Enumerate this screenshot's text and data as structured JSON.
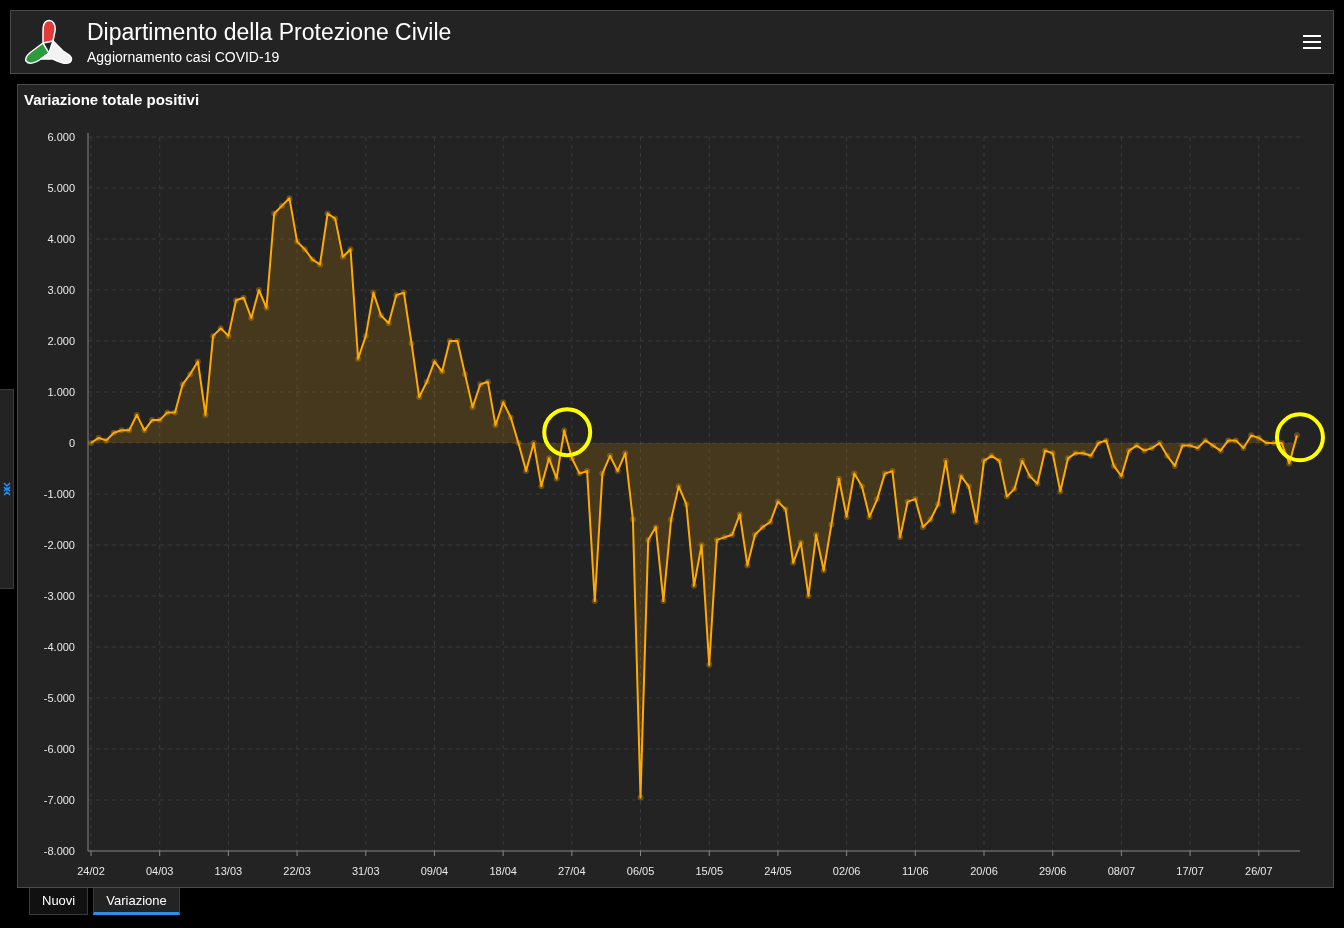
{
  "header": {
    "title": "Dipartimento della Protezione Civile",
    "subtitle": "Aggiornamento casi COVID-19"
  },
  "panel": {
    "title": "Variazione totale positivi",
    "chart_data": {
      "type": "area",
      "grid": true,
      "categories": [
        "24/02",
        null,
        null,
        null,
        null,
        null,
        null,
        null,
        null,
        "04/03",
        null,
        null,
        null,
        null,
        null,
        null,
        null,
        null,
        "13/03",
        null,
        null,
        null,
        null,
        null,
        null,
        null,
        null,
        "22/03",
        null,
        null,
        null,
        null,
        null,
        null,
        null,
        null,
        "31/03",
        null,
        null,
        null,
        null,
        null,
        null,
        null,
        null,
        "09/04",
        null,
        null,
        null,
        null,
        null,
        null,
        null,
        null,
        "18/04",
        null,
        null,
        null,
        null,
        null,
        null,
        null,
        null,
        "27/04",
        null,
        null,
        null,
        null,
        null,
        null,
        null,
        null,
        "06/05",
        null,
        null,
        null,
        null,
        null,
        null,
        null,
        null,
        "15/05",
        null,
        null,
        null,
        null,
        null,
        null,
        null,
        null,
        "24/05",
        null,
        null,
        null,
        null,
        null,
        null,
        null,
        null,
        "02/06",
        null,
        null,
        null,
        null,
        null,
        null,
        null,
        null,
        "11/06",
        null,
        null,
        null,
        null,
        null,
        null,
        null,
        null,
        "20/06",
        null,
        null,
        null,
        null,
        null,
        null,
        null,
        null,
        "29/06",
        null,
        null,
        null,
        null,
        null,
        null,
        null,
        null,
        "08/07",
        null,
        null,
        null,
        null,
        null,
        null,
        null,
        null,
        "17/07",
        null,
        null,
        null,
        null,
        null,
        null,
        null,
        null,
        "26/07",
        null,
        null,
        null,
        null,
        null
      ],
      "series": [
        {
          "color": "#ffaa00",
          "values": [
            0,
            100,
            50,
            200,
            250,
            250,
            550,
            250,
            450,
            450,
            600,
            600,
            1150,
            1350,
            1600,
            550,
            2100,
            2250,
            2100,
            2800,
            2850,
            2450,
            3000,
            2650,
            4500,
            4650,
            4800,
            3950,
            3800,
            3600,
            3500,
            4500,
            4400,
            3650,
            3800,
            1650,
            2100,
            2950,
            2500,
            2350,
            2900,
            2950,
            1950,
            900,
            1200,
            1600,
            1400,
            2000,
            2000,
            1350,
            700,
            1150,
            1200,
            350,
            800,
            500,
            0,
            -550,
            0,
            -850,
            -300,
            -700,
            250,
            -300,
            -600,
            -550,
            -3100,
            -600,
            -250,
            -550,
            -200,
            -1500,
            -6950,
            -1900,
            -1650,
            -3100,
            -1500,
            -850,
            -1200,
            -2800,
            -2000,
            -4350,
            -1900,
            -1850,
            -1800,
            -1400,
            -2400,
            -1800,
            -1650,
            -1550,
            -1150,
            -1300,
            -2350,
            -1950,
            -3000,
            -1800,
            -2500,
            -1600,
            -700,
            -1450,
            -600,
            -850,
            -1450,
            -1100,
            -600,
            -550,
            -1850,
            -1150,
            -1100,
            -1650,
            -1500,
            -1200,
            -350,
            -1350,
            -650,
            -850,
            -1550,
            -350,
            -250,
            -350,
            -1050,
            -900,
            -350,
            -650,
            -800,
            -150,
            -200,
            -950,
            -300,
            -200,
            -200,
            -250,
            0,
            50,
            -450,
            -650,
            -150,
            -50,
            -150,
            -100,
            0,
            -250,
            -450,
            -50,
            -50,
            -100,
            50,
            -50,
            -150,
            50,
            50,
            -100,
            150,
            100,
            0,
            0,
            0,
            -400,
            150
          ]
        }
      ],
      "ylim": [
        -8000,
        6000
      ],
      "yticks": [
        {
          "value": 6000,
          "label": "6.000"
        },
        {
          "value": 5000,
          "label": "5.000"
        },
        {
          "value": 4000,
          "label": "4.000"
        },
        {
          "value": 3000,
          "label": "3.000"
        },
        {
          "value": 2000,
          "label": "2.000"
        },
        {
          "value": 1000,
          "label": "1.000"
        },
        {
          "value": 0,
          "label": "0"
        },
        {
          "value": -1000,
          "label": "-1.000"
        },
        {
          "value": -2000,
          "label": "-2.000"
        },
        {
          "value": -3000,
          "label": "-3.000"
        },
        {
          "value": -4000,
          "label": "-4.000"
        },
        {
          "value": -5000,
          "label": "-5.000"
        },
        {
          "value": -6000,
          "label": "-6.000"
        },
        {
          "value": -7000,
          "label": "-7.000"
        },
        {
          "value": -8000,
          "label": "-8.000"
        }
      ]
    },
    "circled": [
      false,
      false,
      false,
      false,
      false,
      false,
      false,
      false,
      false,
      false,
      false,
      false,
      false,
      false,
      false,
      false,
      false,
      false,
      false,
      false,
      false,
      false,
      false,
      false,
      false,
      false,
      false,
      false,
      false,
      false,
      false,
      false,
      false,
      false,
      false,
      false,
      false,
      false,
      false,
      false,
      false,
      false,
      false,
      false,
      false,
      false,
      false,
      false,
      false,
      false,
      false,
      false,
      false,
      false,
      false,
      false,
      false,
      false,
      false,
      false,
      false,
      false,
      true,
      false,
      false,
      false,
      false,
      false,
      false,
      false,
      false,
      false,
      false,
      false,
      false,
      false,
      false,
      false,
      false,
      false,
      false,
      false,
      false,
      false,
      false,
      false,
      false,
      false,
      false,
      false,
      false,
      false,
      false,
      false,
      false,
      false,
      false,
      false,
      false,
      false,
      false,
      false,
      false,
      false,
      false,
      false,
      false,
      false,
      false,
      false,
      false,
      false,
      false,
      false,
      false,
      false,
      false,
      false,
      false,
      false,
      false,
      false,
      false,
      false,
      false,
      false,
      false,
      false,
      false,
      false,
      false,
      false,
      false,
      false,
      false,
      false,
      false,
      false,
      false,
      false,
      false,
      false,
      false,
      false,
      false,
      false,
      false,
      false,
      false,
      false,
      false,
      false,
      false,
      false,
      false,
      false,
      false,
      false,
      true
    ]
  },
  "tabs": [
    {
      "label": "Nuovi",
      "selected": false
    },
    {
      "label": "Variazione",
      "selected": true
    }
  ]
}
